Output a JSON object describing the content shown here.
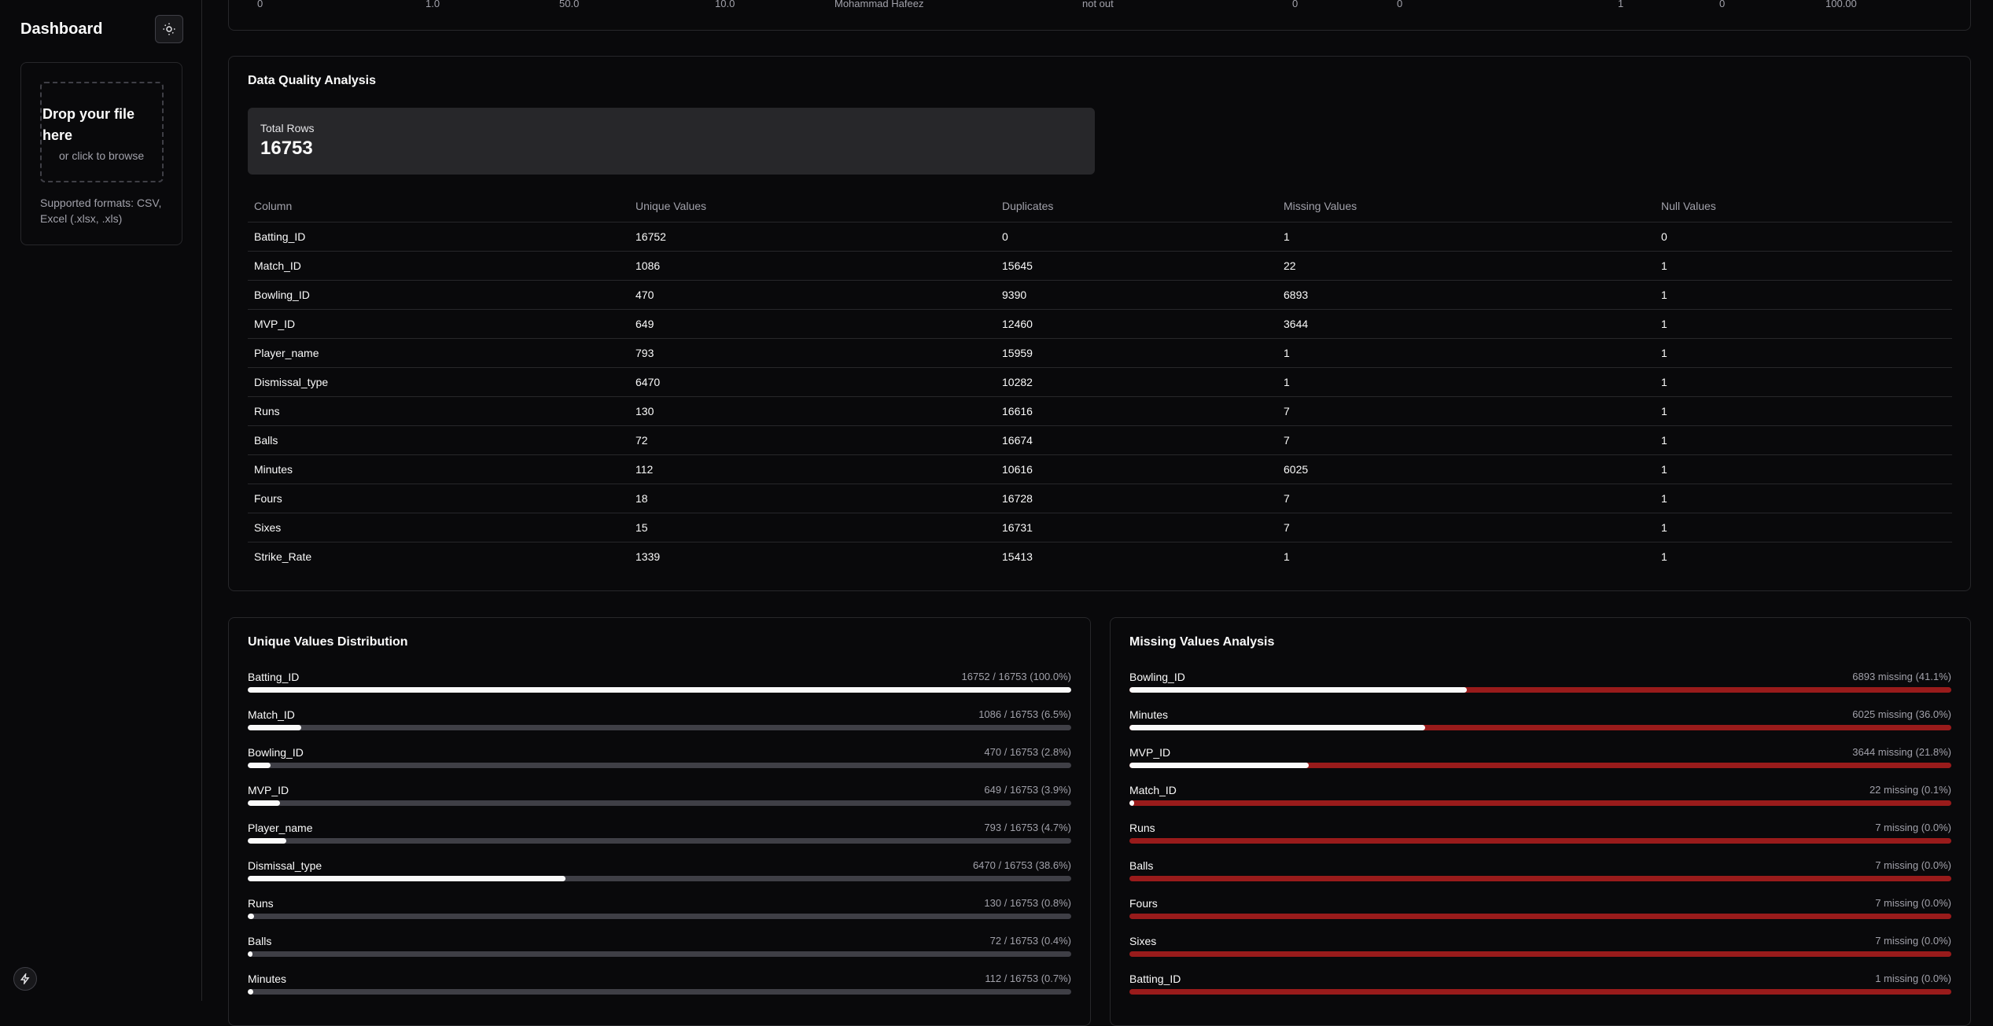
{
  "sidebar": {
    "title": "Dashboard",
    "dropzone_title": "Drop your file here",
    "dropzone_sub": "or click to browse",
    "formats": "Supported formats: CSV, Excel (.xlsx, .xls)"
  },
  "preview_row": [
    "0",
    "1.0",
    "50.0",
    "10.0",
    "Mohammad Hafeez",
    "not out",
    "0",
    "0",
    "1",
    "0",
    "100.00"
  ],
  "quality": {
    "title": "Data Quality Analysis",
    "total_label": "Total Rows",
    "total_value": "16753",
    "headers": [
      "Column",
      "Unique Values",
      "Duplicates",
      "Missing Values",
      "Null Values"
    ],
    "rows": [
      [
        "Batting_ID",
        "16752",
        "0",
        "1",
        "0"
      ],
      [
        "Match_ID",
        "1086",
        "15645",
        "22",
        "1"
      ],
      [
        "Bowling_ID",
        "470",
        "9390",
        "6893",
        "1"
      ],
      [
        "MVP_ID",
        "649",
        "12460",
        "3644",
        "1"
      ],
      [
        "Player_name",
        "793",
        "15959",
        "1",
        "1"
      ],
      [
        "Dismissal_type",
        "6470",
        "10282",
        "1",
        "1"
      ],
      [
        "Runs",
        "130",
        "16616",
        "7",
        "1"
      ],
      [
        "Balls",
        "72",
        "16674",
        "7",
        "1"
      ],
      [
        "Minutes",
        "112",
        "10616",
        "6025",
        "1"
      ],
      [
        "Fours",
        "18",
        "16728",
        "7",
        "1"
      ],
      [
        "Sixes",
        "15",
        "16731",
        "7",
        "1"
      ],
      [
        "Strike_Rate",
        "1339",
        "15413",
        "1",
        "1"
      ]
    ]
  },
  "unique_dist": {
    "title": "Unique Values Distribution",
    "items": [
      {
        "name": "Batting_ID",
        "label": "16752 / 16753 (100.0%)",
        "fraction": 1.0
      },
      {
        "name": "Match_ID",
        "label": "1086 / 16753 (6.5%)",
        "fraction": 0.065
      },
      {
        "name": "Bowling_ID",
        "label": "470 / 16753 (2.8%)",
        "fraction": 0.028
      },
      {
        "name": "MVP_ID",
        "label": "649 / 16753 (3.9%)",
        "fraction": 0.039
      },
      {
        "name": "Player_name",
        "label": "793 / 16753 (4.7%)",
        "fraction": 0.047
      },
      {
        "name": "Dismissal_type",
        "label": "6470 / 16753 (38.6%)",
        "fraction": 0.386
      },
      {
        "name": "Runs",
        "label": "130 / 16753 (0.8%)",
        "fraction": 0.008
      },
      {
        "name": "Balls",
        "label": "72 / 16753 (0.4%)",
        "fraction": 0.004
      },
      {
        "name": "Minutes",
        "label": "112 / 16753 (0.7%)",
        "fraction": 0.007
      }
    ]
  },
  "missing": {
    "title": "Missing Values Analysis",
    "items": [
      {
        "name": "Bowling_ID",
        "label": "6893 missing (41.1%)",
        "present_fraction": 0.411
      },
      {
        "name": "Minutes",
        "label": "6025 missing (36.0%)",
        "present_fraction": 0.36
      },
      {
        "name": "MVP_ID",
        "label": "3644 missing (21.8%)",
        "present_fraction": 0.218
      },
      {
        "name": "Match_ID",
        "label": "22 missing (0.1%)",
        "present_fraction": 0.001
      },
      {
        "name": "Runs",
        "label": "7 missing (0.0%)",
        "present_fraction": 0.0
      },
      {
        "name": "Balls",
        "label": "7 missing (0.0%)",
        "present_fraction": 0.0
      },
      {
        "name": "Fours",
        "label": "7 missing (0.0%)",
        "present_fraction": 0.0
      },
      {
        "name": "Sixes",
        "label": "7 missing (0.0%)",
        "present_fraction": 0.0
      },
      {
        "name": "Batting_ID",
        "label": "1 missing (0.0%)",
        "present_fraction": 0.0
      }
    ]
  }
}
